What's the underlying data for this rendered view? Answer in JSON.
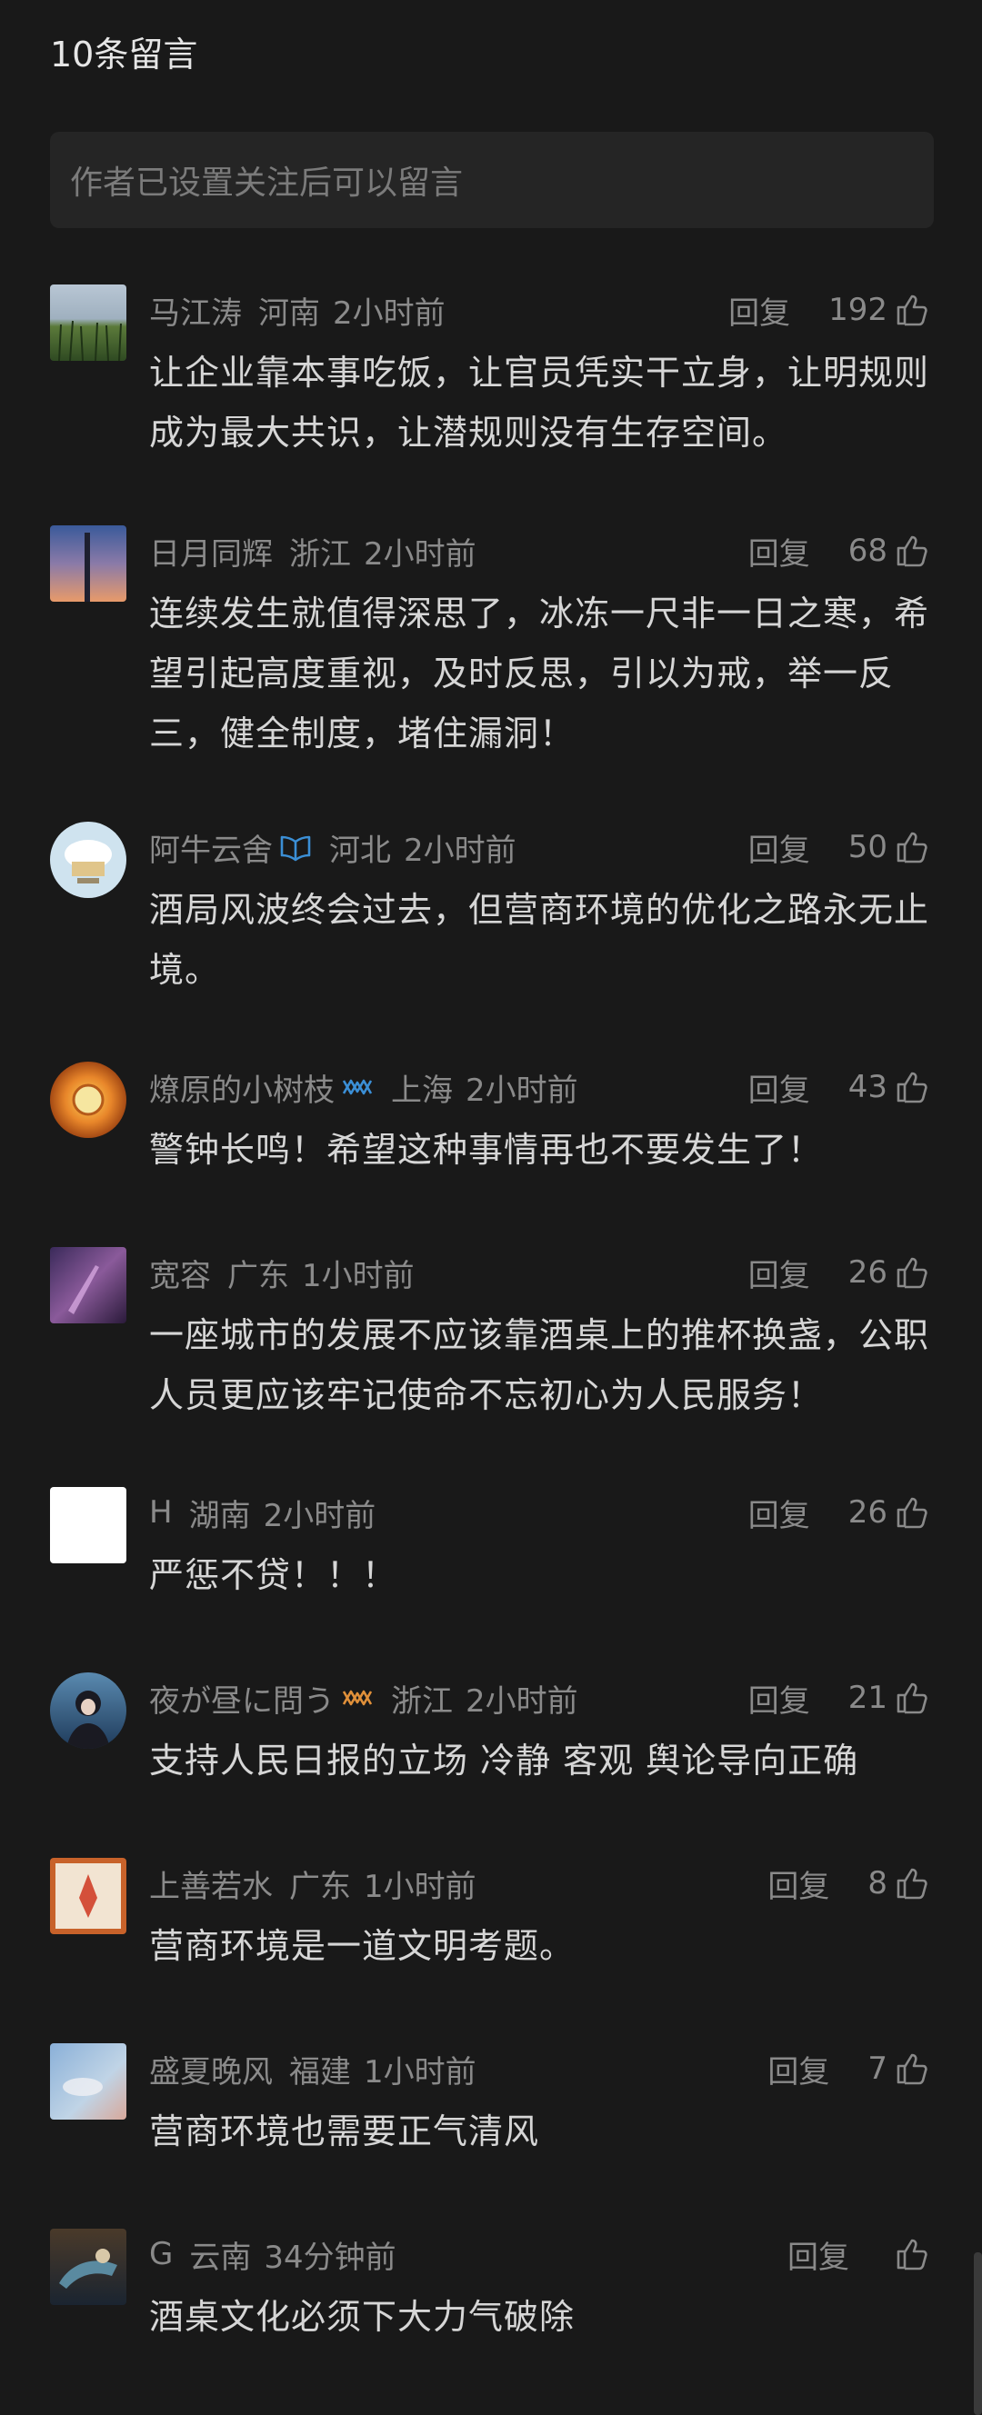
{
  "header": {
    "count_title": "10条留言",
    "notice": "作者已设置关注后可以留言"
  },
  "reply_label": "回复",
  "comments": [
    {
      "nickname": "马江涛",
      "region": "河南",
      "time": "2小时前",
      "likes": "192",
      "text": "让企业靠本事吃饭，让官员凭实干立身，让明规则成为最大共识，让潜规则没有生存空间。"
    },
    {
      "nickname": "日月同辉",
      "region": "浙江",
      "time": "2小时前",
      "likes": "68",
      "text": "连续发生就值得深思了，冰冻一尺非一日之寒，希望引起高度重视，及时反思，引以为戒，举一反三，健全制度，堵住漏洞！"
    },
    {
      "nickname": "阿牛云舍",
      "region": "河北",
      "time": "2小时前",
      "likes": "50",
      "text": "酒局风波终会过去，但营商环境的优化之路永无止境。",
      "badge": "book-badge-icon",
      "badge_color": "#3b8fd6"
    },
    {
      "nickname": "燎原的小树枝",
      "region": "上海",
      "time": "2小时前",
      "likes": "43",
      "text": "警钟长鸣！希望这种事情再也不要发生了！",
      "badge": "infinity-badge-icon",
      "badge_color": "#3b8fd6"
    },
    {
      "nickname": "宽容",
      "region": "广东",
      "time": "1小时前",
      "likes": "26",
      "text": "一座城市的发展不应该靠酒桌上的推杯换盏，公职人员更应该牢记使命不忘初心为人民服务！"
    },
    {
      "nickname": "H",
      "region": "湖南",
      "time": "2小时前",
      "likes": "26",
      "text": "严惩不贷！！！"
    },
    {
      "nickname": "夜が昼に問う",
      "region": "浙江",
      "time": "2小时前",
      "likes": "21",
      "text": "支持人民日报的立场 冷静 客观 舆论导向正确",
      "badge": "infinity-badge-icon",
      "badge_color": "#e0903a"
    },
    {
      "nickname": "上善若水",
      "region": "广东",
      "time": "1小时前",
      "likes": "8",
      "text": "营商环境是一道文明考题。"
    },
    {
      "nickname": "盛夏晚风",
      "region": "福建",
      "time": "1小时前",
      "likes": "7",
      "text": "营商环境也需要正气清风"
    },
    {
      "nickname": "G",
      "region": "云南",
      "time": "34分钟前",
      "likes": "",
      "text": "酒桌文化必须下大力气破除"
    }
  ]
}
